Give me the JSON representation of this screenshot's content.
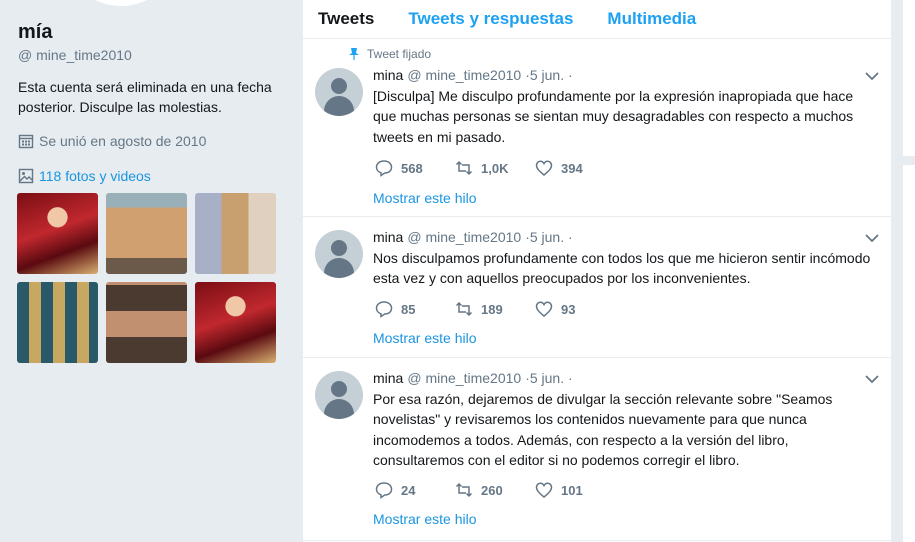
{
  "profile": {
    "name": "mía",
    "handle": "@ mine_time2010",
    "bio": "Esta cuenta será eliminada en una fecha posterior. Disculpe las molestias.",
    "joined": "Se unió en agosto de 2010",
    "media_link": "118 fotos y videos"
  },
  "tabs": [
    "Tweets",
    "Tweets y respuestas",
    "Multimedia"
  ],
  "tweets": [
    {
      "pinned_label": "Tweet fijado",
      "name": "mina",
      "handle": "@ mine_time2010",
      "date": "·5 jun. ·",
      "text": "[Disculpa] Me disculpo profundamente por la expresión inapropiada que hace que muchas personas se sientan muy desagradables con respecto a muchos tweets en mi pasado.",
      "replies": "568",
      "retweets": "1,0K",
      "likes": "394",
      "thread": "Mostrar este hilo"
    },
    {
      "name": "mina",
      "handle": "@ mine_time2010",
      "date": "·5 jun. ·",
      "text": "Nos disculpamos profundamente con todos los que me hicieron sentir incómodo esta vez y con aquellos preocupados por los inconvenientes.",
      "replies": "85",
      "retweets": "189",
      "likes": "93",
      "thread": "Mostrar este hilo"
    },
    {
      "name": "mina",
      "handle": "@ mine_time2010",
      "date": "·5 jun. ·",
      "text": "Por esa razón, dejaremos de divulgar la sección relevante sobre \"Seamos novelistas\" y revisaremos los contenidos nuevamente para que nunca incomodemos a todos. Además, con respecto a la versión del libro, consultaremos con el editor si no podemos corregir el libro.",
      "replies": "24",
      "retweets": "260",
      "likes": "101",
      "thread": "Mostrar este hilo"
    }
  ],
  "colors": {
    "accent": "#1da1f2",
    "link": "#1b95e0",
    "muted": "#657786",
    "bg": "#e6ecf0"
  }
}
